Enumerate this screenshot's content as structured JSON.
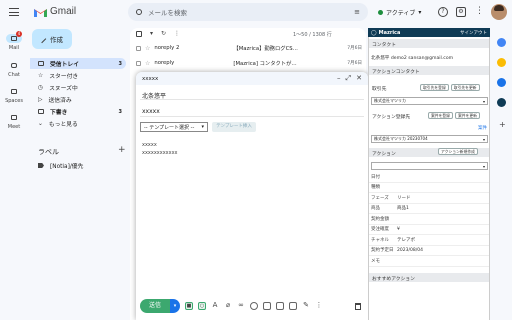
{
  "app": {
    "name": "Gmail"
  },
  "search": {
    "placeholder": "メールを検索"
  },
  "status": {
    "label": "アクティブ",
    "color": "#1e8e3e"
  },
  "rail": [
    {
      "label": "Mail",
      "badge": "4"
    },
    {
      "label": "Chat"
    },
    {
      "label": "Spaces"
    },
    {
      "label": "Meet"
    }
  ],
  "compose": {
    "label": "作成"
  },
  "nav": [
    {
      "label": "受信トレイ",
      "count": "3"
    },
    {
      "label": "スター付き",
      "count": ""
    },
    {
      "label": "スヌーズ中",
      "count": ""
    },
    {
      "label": "送信済み",
      "count": ""
    },
    {
      "label": "下書き",
      "count": "3"
    },
    {
      "label": "もっと見る",
      "count": ""
    }
  ],
  "labels": {
    "heading": "ラベル",
    "items": [
      "[Notia]/優先"
    ]
  },
  "toolbar": {
    "pager": "1～50 / 1308 行"
  },
  "mails": [
    {
      "from": "noreply 2",
      "subject": "【Mazrica】勤務ログCS…",
      "time": "7月6日"
    },
    {
      "from": "noreply",
      "subject": "[Mazrica] コンタクトが…",
      "time": "7月6日"
    },
    {
      "from": "noreply",
      "subject": "【Mazrica】…",
      "time": "7月6日"
    }
  ],
  "composeWindow": {
    "title": "xxxxx",
    "to": "北条悠平",
    "subject": "xxxxx",
    "template_select": "-- テンプレート選択 --",
    "template_button": "テンプレート挿入",
    "body": [
      "xxxxx",
      "xxxxxxxxxxxx"
    ],
    "send_label": "送信"
  },
  "mazrica": {
    "brand": "Mazrica",
    "logout": "サインアウト",
    "contact_header": "コンタクト",
    "contact_email": "北条悠平 demo2 sansan@gmail.com",
    "action_contact_header": "アクションコンタクト",
    "customer_label": "取引先",
    "customer_buttons": [
      "取引先を登録",
      "取引先を更新"
    ],
    "customer_value": "株式会社マツリカ",
    "deal_label": "アクション登録先",
    "deal_buttons": [
      "案件を登録",
      "案件を更新"
    ],
    "deal_value": "株式会社マツリカ 20230704",
    "deal_link": "案件",
    "action_label": "アクション",
    "action_button": "アクション新規作成",
    "fields": [
      {
        "k": "日付",
        "v": ""
      },
      {
        "k": "種類",
        "v": ""
      },
      {
        "k": "フェーズ",
        "v": "リード"
      },
      {
        "k": "商品",
        "v": "商品1"
      },
      {
        "k": "契約金額",
        "v": ""
      },
      {
        "k": "受注確度",
        "v": "¥"
      },
      {
        "k": "チャネル",
        "v": "テレアポ"
      },
      {
        "k": "契約予定日",
        "v": "2023/08/04"
      },
      {
        "k": "メモ",
        "v": ""
      }
    ],
    "recommend_header": "おすすめアクション"
  }
}
